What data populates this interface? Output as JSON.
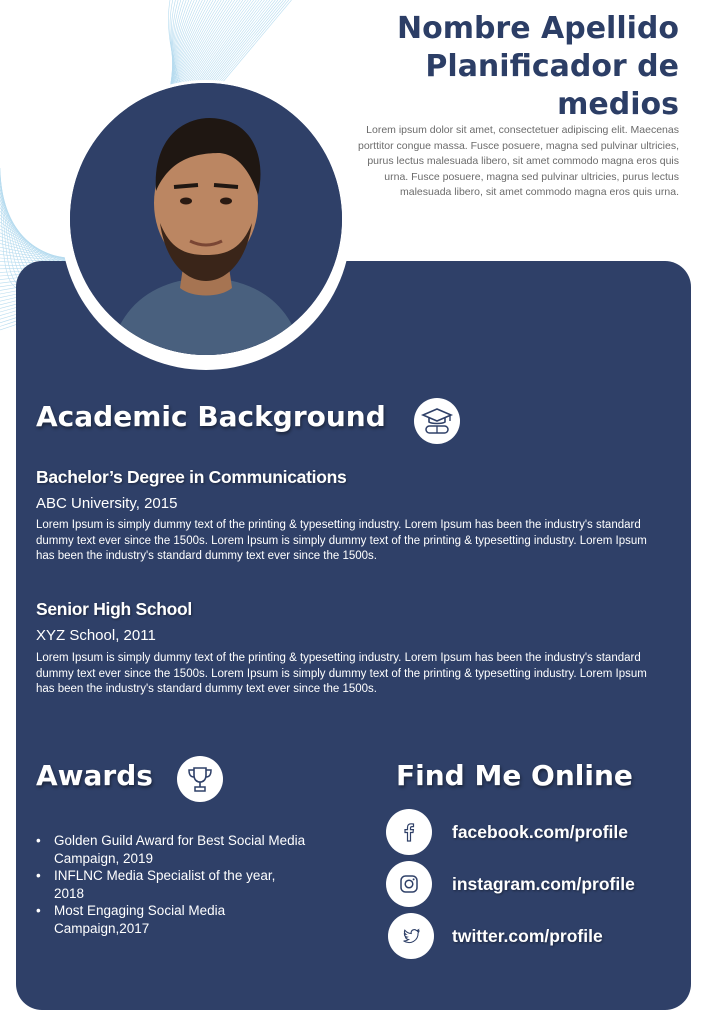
{
  "header": {
    "name": "Nombre Apellido",
    "role_line1": "Planificador de",
    "role_line2": "medios",
    "intro": "Lorem ipsum dolor sit amet, consectetuer adipiscing elit. Maecenas porttitor congue massa. Fusce posuere, magna sed pulvinar ultricies, purus lectus malesuada libero, sit amet commodo magna eros quis urna. Fusce posuere, magna sed pulvinar ultricies, purus lectus malesuada libero, sit amet commodo magna eros quis urna."
  },
  "academic": {
    "title": "Academic Background",
    "icon": "graduation-cap-diploma-icon",
    "entries": [
      {
        "degree": "Bachelor’s Degree in Communications",
        "institution": "ABC University,  2015",
        "description": "Lorem Ipsum is simply dummy text of the printing & typesetting industry. Lorem Ipsum has been the industry's standard dummy text ever since the 1500s. Lorem Ipsum is simply dummy text of the printing & typesetting industry. Lorem Ipsum has been the industry's standard dummy text ever since the 1500s."
      },
      {
        "degree": "Senior High School",
        "institution": "XYZ School, 2011",
        "description": "Lorem Ipsum is simply dummy text of the printing & typesetting industry. Lorem Ipsum has been the industry's standard dummy text ever since the 1500s. Lorem Ipsum is simply dummy text of the printing & typesetting industry. Lorem Ipsum has been the industry's standard dummy text ever since the 1500s."
      }
    ]
  },
  "awards": {
    "title": "Awards",
    "icon": "trophy-icon",
    "items": [
      "Golden Guild Award for Best Social Media Campaign, 2019",
      "INFLNC Media Specialist of the year, 2018",
      "Most Engaging Social Media Campaign,2017"
    ]
  },
  "online": {
    "title": "Find Me Online",
    "links": [
      {
        "icon": "facebook-icon",
        "text": "facebook.com/profile"
      },
      {
        "icon": "instagram-icon",
        "text": "instagram.com/profile"
      },
      {
        "icon": "twitter-icon",
        "text": "twitter.com/profile"
      }
    ]
  },
  "colors": {
    "panel": "#2f4068",
    "heading": "#2c3e66",
    "muted_text": "#6b6b6b",
    "decor_lines": "#9fd0ea"
  }
}
